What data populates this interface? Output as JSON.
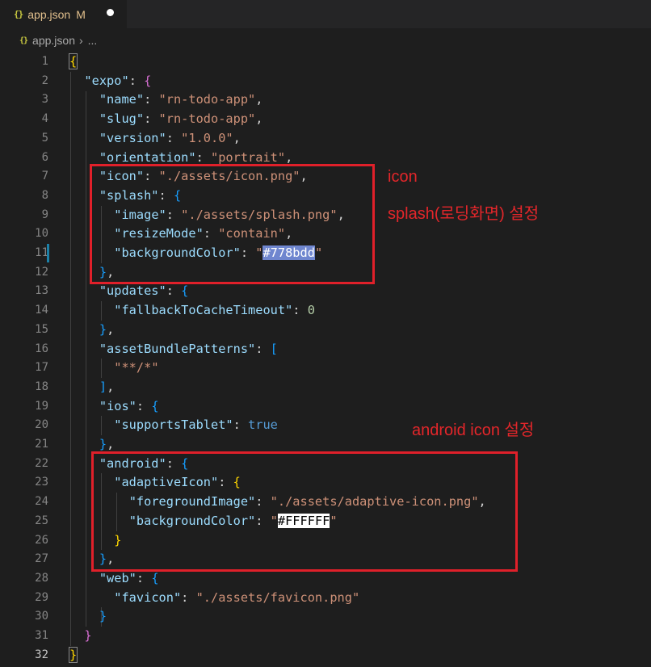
{
  "tab": {
    "icon": "{}",
    "filename": "app.json",
    "modified": "M"
  },
  "breadcrumb": {
    "icon": "{}",
    "file": "app.json",
    "separator": "›",
    "rest": "..."
  },
  "line_numbers": [
    "1",
    "2",
    "3",
    "4",
    "5",
    "6",
    "7",
    "8",
    "9",
    "10",
    "11",
    "12",
    "13",
    "14",
    "15",
    "16",
    "17",
    "18",
    "19",
    "20",
    "21",
    "22",
    "23",
    "24",
    "25",
    "26",
    "27",
    "28",
    "29",
    "30",
    "31",
    "32"
  ],
  "code": {
    "l1_open": "{",
    "expo_key": "\"expo\"",
    "name_key": "\"name\"",
    "name_val": "\"rn-todo-app\"",
    "slug_key": "\"slug\"",
    "slug_val": "\"rn-todo-app\"",
    "version_key": "\"version\"",
    "version_val": "\"1.0.0\"",
    "orientation_key": "\"orientation\"",
    "orientation_val": "\"portrait\"",
    "icon_key": "\"icon\"",
    "icon_val": "\"./assets/icon.png\"",
    "splash_key": "\"splash\"",
    "image_key": "\"image\"",
    "image_val": "\"./assets/splash.png\"",
    "resize_key": "\"resizeMode\"",
    "resize_val": "\"contain\"",
    "bg_key": "\"backgroundColor\"",
    "bg_val": "#778bdd",
    "updates_key": "\"updates\"",
    "fallback_key": "\"fallbackToCacheTimeout\"",
    "fallback_val": "0",
    "abp_key": "\"assetBundlePatterns\"",
    "abp_val": "\"**/*\"",
    "ios_key": "\"ios\"",
    "tablet_key": "\"supportsTablet\"",
    "tablet_val": "true",
    "android_key": "\"android\"",
    "adaptive_key": "\"adaptiveIcon\"",
    "fg_key": "\"foregroundImage\"",
    "fg_val": "\"./assets/adaptive-icon.png\"",
    "abg_key": "\"backgroundColor\"",
    "abg_val": "#FFFFFF",
    "web_key": "\"web\"",
    "favicon_key": "\"favicon\"",
    "favicon_val": "\"./assets/favicon.png\""
  },
  "annotations": {
    "icon": "icon",
    "splash": "splash(로딩화면) 설정",
    "android": "android icon 설정"
  },
  "colors": {
    "highlight_box": "#e0202a",
    "annotation_text": "#e3262a",
    "swatch_blue": "#778bdd"
  }
}
